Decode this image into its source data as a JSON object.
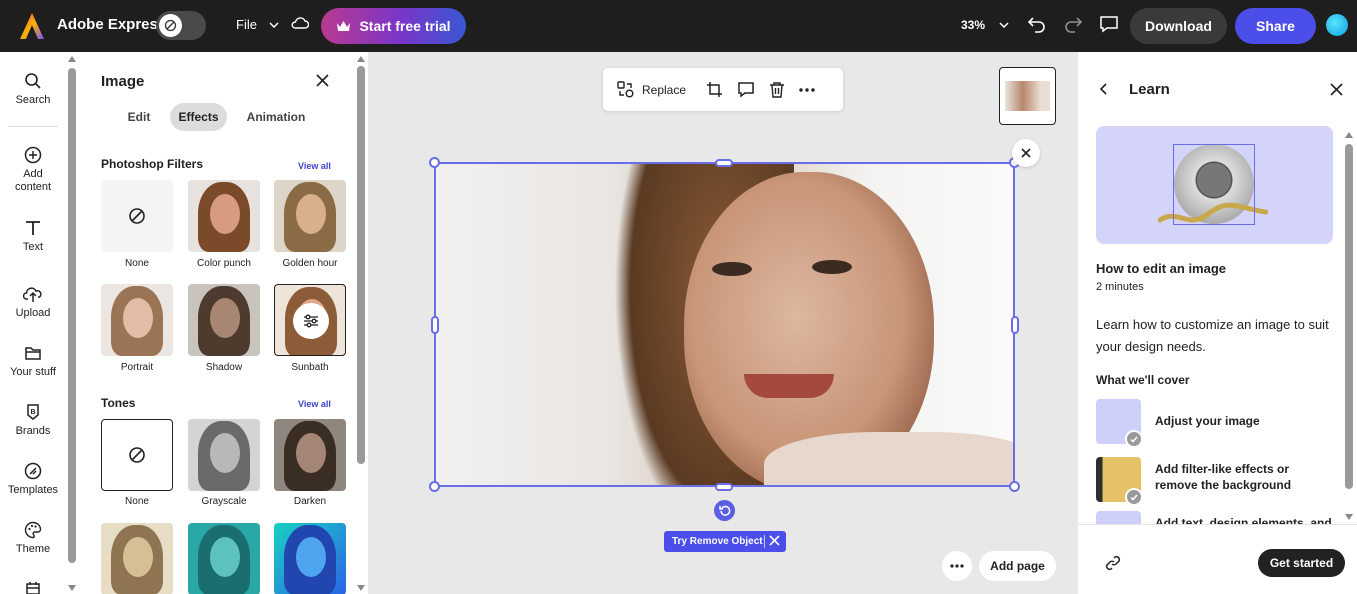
{
  "topbar": {
    "brand": "Adobe Express",
    "file_label": "File",
    "trial_label": "Start free trial",
    "zoom": "33%",
    "download_label": "Download",
    "share_label": "Share",
    "brand_colors": {
      "share": "#4b4ee8",
      "trial_start": "#b93a8f",
      "trial_end": "#3a57d4"
    }
  },
  "rail": {
    "items": [
      {
        "label": "Search",
        "icon": "search-icon"
      },
      {
        "label": "Add content",
        "icon": "add-circle-icon"
      },
      {
        "label": "Text",
        "icon": "text-icon"
      },
      {
        "label": "Upload",
        "icon": "upload-icon"
      },
      {
        "label": "Your stuff",
        "icon": "folder-icon"
      },
      {
        "label": "Brands",
        "icon": "brand-icon"
      },
      {
        "label": "Templates",
        "icon": "templates-icon"
      },
      {
        "label": "Theme",
        "icon": "palette-icon"
      }
    ]
  },
  "panel": {
    "title": "Image",
    "tabs": [
      {
        "label": "Edit"
      },
      {
        "label": "Effects",
        "active": true
      },
      {
        "label": "Animation"
      }
    ],
    "photoshop_filters": {
      "title": "Photoshop Filters",
      "view_all": "View all",
      "items": [
        {
          "label": "None"
        },
        {
          "label": "Color punch"
        },
        {
          "label": "Golden hour"
        },
        {
          "label": "Portrait"
        },
        {
          "label": "Shadow"
        },
        {
          "label": "Sunbath",
          "selected": true
        }
      ]
    },
    "tones": {
      "title": "Tones",
      "view_all": "View all",
      "items": [
        {
          "label": "None",
          "selected": true
        },
        {
          "label": "Grayscale"
        },
        {
          "label": "Darken"
        }
      ]
    }
  },
  "canvas": {
    "toolbar": {
      "replace_label": "Replace"
    },
    "remove_object_label": "Try Remove Object",
    "add_page_label": "Add page"
  },
  "learn": {
    "title": "Learn",
    "heading": "How to edit an image",
    "duration": "2 minutes",
    "description": "Learn how to customize an image to suit your design needs.",
    "cover_title": "What we'll cover",
    "cover_items": [
      {
        "label": "Adjust your image"
      },
      {
        "label": "Add filter-like effects or remove the background"
      },
      {
        "label": "Add text, design elements, and"
      }
    ],
    "get_started_label": "Get started"
  }
}
